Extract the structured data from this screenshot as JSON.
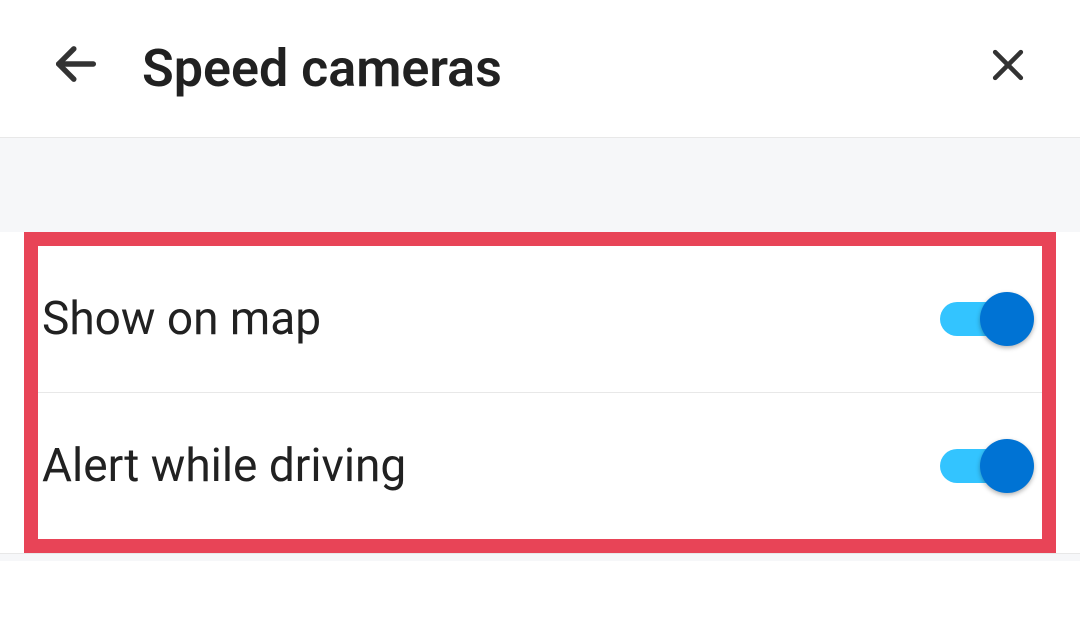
{
  "header": {
    "title": "Speed cameras"
  },
  "settings": {
    "show_on_map": {
      "label": "Show on map",
      "enabled": true
    },
    "alert_while_driving": {
      "label": "Alert while driving",
      "enabled": true
    }
  }
}
